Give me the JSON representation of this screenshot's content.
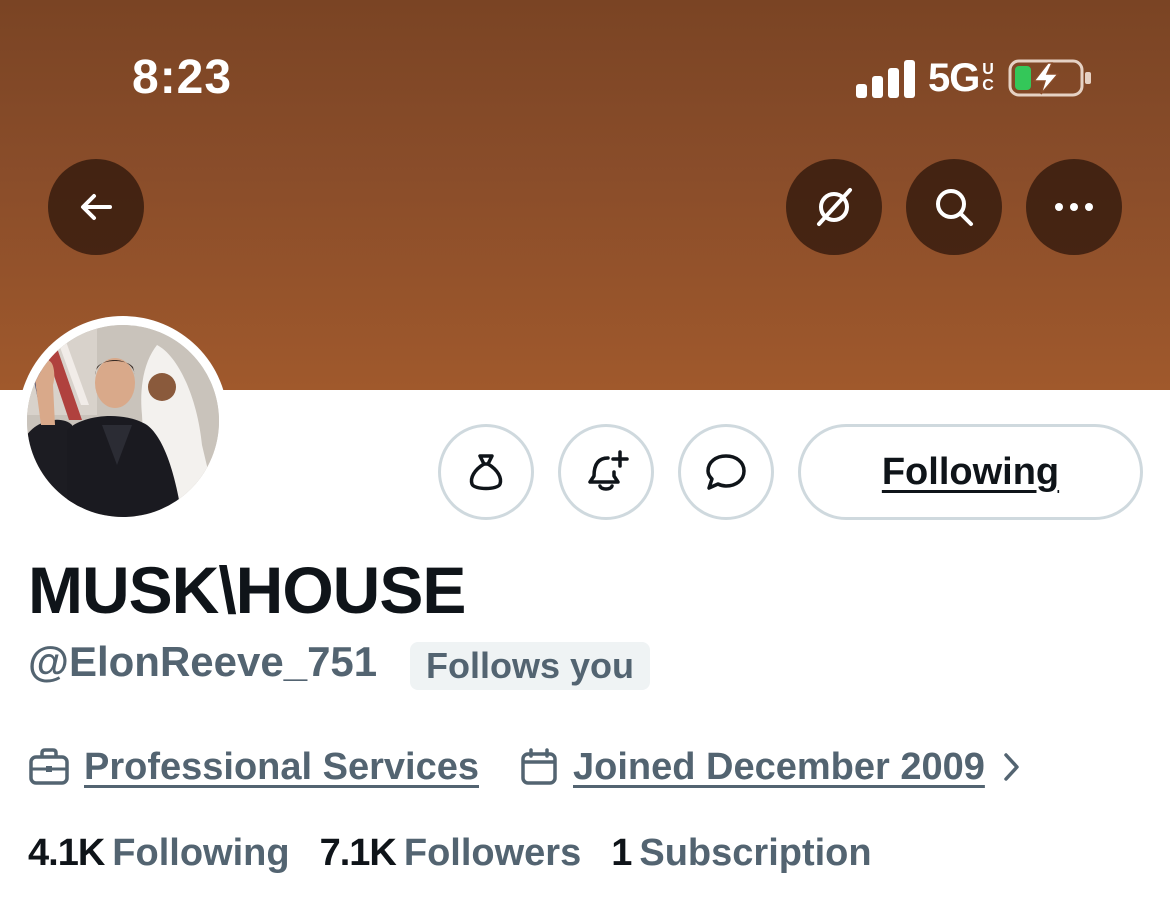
{
  "status_bar": {
    "time": "8:23",
    "network": "5G",
    "network_sup": "UC",
    "battery_color": "#34c759"
  },
  "banner": {
    "color": "#8a4d2a"
  },
  "top_actions": {
    "back_icon": "arrow-left-icon",
    "grok_icon": "grok-icon",
    "search_icon": "search-icon",
    "more_icon": "more-icon"
  },
  "profile": {
    "display_name": "MUSK\\HOUSE",
    "handle": "@ElonReeve_751",
    "follows_you_badge": "Follows you",
    "category": "Professional Services",
    "joined": "Joined December 2009"
  },
  "actions": {
    "tip_icon": "money-bag-icon",
    "notify_icon": "bell-plus-icon",
    "message_icon": "message-icon",
    "following_label": "Following"
  },
  "stats": {
    "following_count": "4.1K",
    "following_label": "Following",
    "followers_count": "7.1K",
    "followers_label": "Followers",
    "subscription_count": "1",
    "subscription_label": "Subscription"
  }
}
